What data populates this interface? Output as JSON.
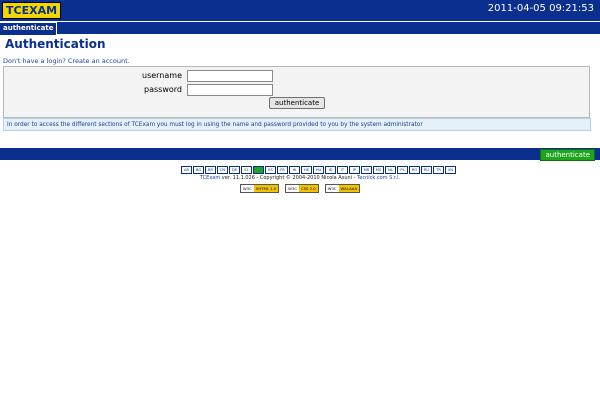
{
  "header": {
    "logo_text": "TCEXAM",
    "datetime": "2011-04-05 09:21:53"
  },
  "tabs": {
    "active_tab": "authenticate"
  },
  "page": {
    "title": "Authentication",
    "signup_link": "Don't have a login? Create an account."
  },
  "login_form": {
    "username_label": "username",
    "password_label": "password",
    "username_value": "",
    "password_value": "",
    "submit_label": "authenticate"
  },
  "info_message": "In order to access the different sections of TCExam you must log in using the name and password provided to you by the system administrator",
  "bottom_bar": {
    "action_label": "authenticate"
  },
  "languages": [
    "AR",
    "BG",
    "BR",
    "CN",
    "DE",
    "EL",
    "EN",
    "ES",
    "FR",
    "HI",
    "HE",
    "HU",
    "ID",
    "IT",
    "JP",
    "MR",
    "MS",
    "NL",
    "PL",
    "RO",
    "RU",
    "TR",
    "VN"
  ],
  "active_language": "EN",
  "footer": {
    "product_link": "TCExam",
    "version_text": " ver. 11.1.026 - Copyright © 2004-2010 Nicola Asuni - ",
    "company_link": "Tecnick.com S.r.l."
  },
  "badges": [
    {
      "org": "W3C",
      "standard": "XHTML 1.0"
    },
    {
      "org": "W3C",
      "standard": "CSS 2.0"
    },
    {
      "org": "W3C",
      "standard": "WAI-AAA"
    }
  ],
  "colors": {
    "header_blue": "#0a2f8f",
    "logo_yellow": "#f3d500",
    "action_green": "#1ea51e",
    "info_bg": "#e6f0fb"
  }
}
